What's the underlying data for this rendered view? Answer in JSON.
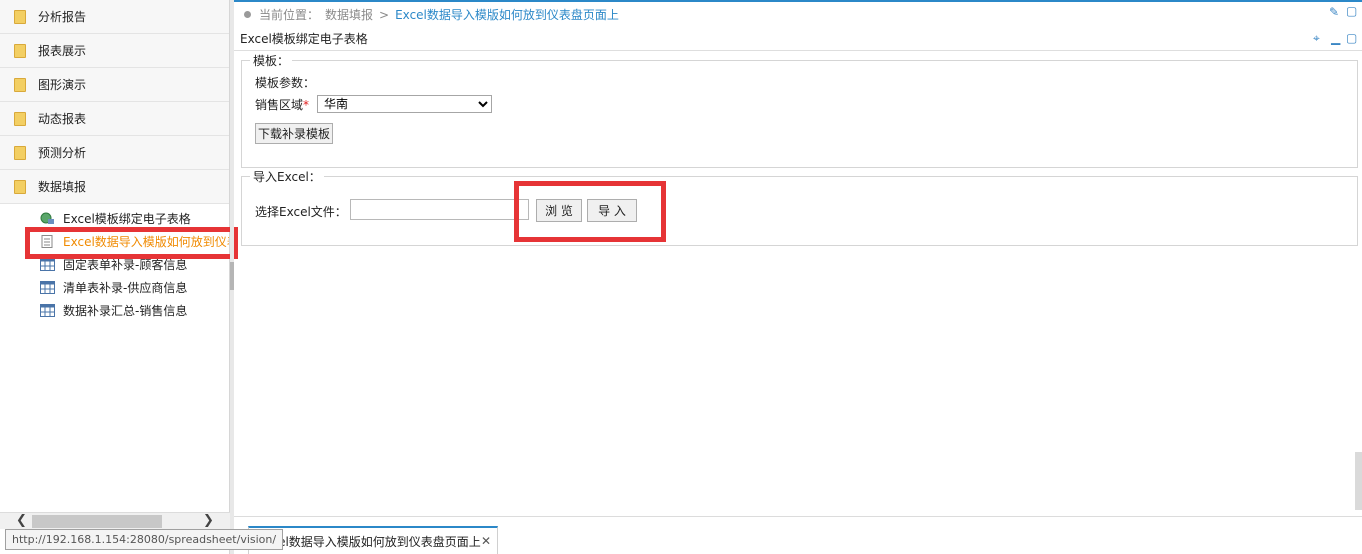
{
  "sidebar": {
    "categories": [
      "分析报告",
      "报表展示",
      "图形演示",
      "动态报表",
      "预测分析",
      "数据填报"
    ],
    "subitems": [
      {
        "label": "Excel模板绑定电子表格",
        "icon": "globe-link-icon"
      },
      {
        "label": "Excel数据导入模版如何放到仪表盘页面上",
        "icon": "document-icon",
        "active": true
      },
      {
        "label": "固定表单补录-顾客信息",
        "icon": "grid-icon"
      },
      {
        "label": "清单表补录-供应商信息",
        "icon": "grid-icon"
      },
      {
        "label": "数据补录汇总-销售信息",
        "icon": "grid-icon"
      }
    ]
  },
  "breadcrumb": {
    "prefix": "当前位置：",
    "parent": "数据填报",
    "separator": ">",
    "current": "Excel数据导入模版如何放到仪表盘页面上"
  },
  "panel": {
    "title": "Excel模板绑定电子表格"
  },
  "template_section": {
    "legend": "模板：",
    "params_label": "模板参数：",
    "region_label": "销售区域",
    "required_mark": "*",
    "region_value": "华南",
    "download_button": "下载补录模板"
  },
  "import_section": {
    "legend": "导入Excel：",
    "file_label": "选择Excel文件：",
    "browse_button": "浏 览",
    "import_button": "导 入"
  },
  "tab": {
    "label": "Excel数据导入模版如何放到仪表盘页面上",
    "close": "✕"
  },
  "status_url": "http://192.168.1.154:28080/spreadsheet/vision/",
  "colors": {
    "accent": "#2b88c8",
    "highlight": "#e63436",
    "active_item": "#f08a00"
  }
}
